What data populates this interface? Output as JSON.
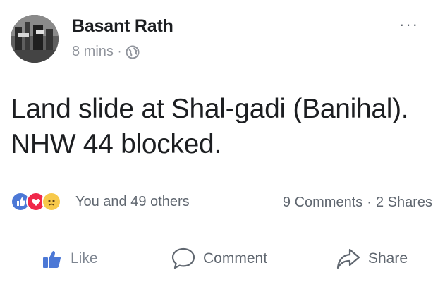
{
  "post": {
    "author": "Basant Rath",
    "time": "8 mins",
    "privacy_icon": "globe-icon",
    "more_label": "···",
    "text": "Land slide at Shal-gadi (Banihal). NHW 44 blocked."
  },
  "reactions": {
    "icons": [
      "like-reaction-icon",
      "love-reaction-icon",
      "sad-reaction-icon"
    ],
    "summary": "You and 49 others",
    "comments": "9 Comments",
    "separator": "·",
    "shares": "2 Shares"
  },
  "actions": {
    "like": "Like",
    "comment": "Comment",
    "share": "Share"
  },
  "colors": {
    "like_blue": "#4c78d6",
    "love_red": "#f0284a",
    "sad_yellow": "#f7c94b",
    "muted_text": "#606770"
  }
}
